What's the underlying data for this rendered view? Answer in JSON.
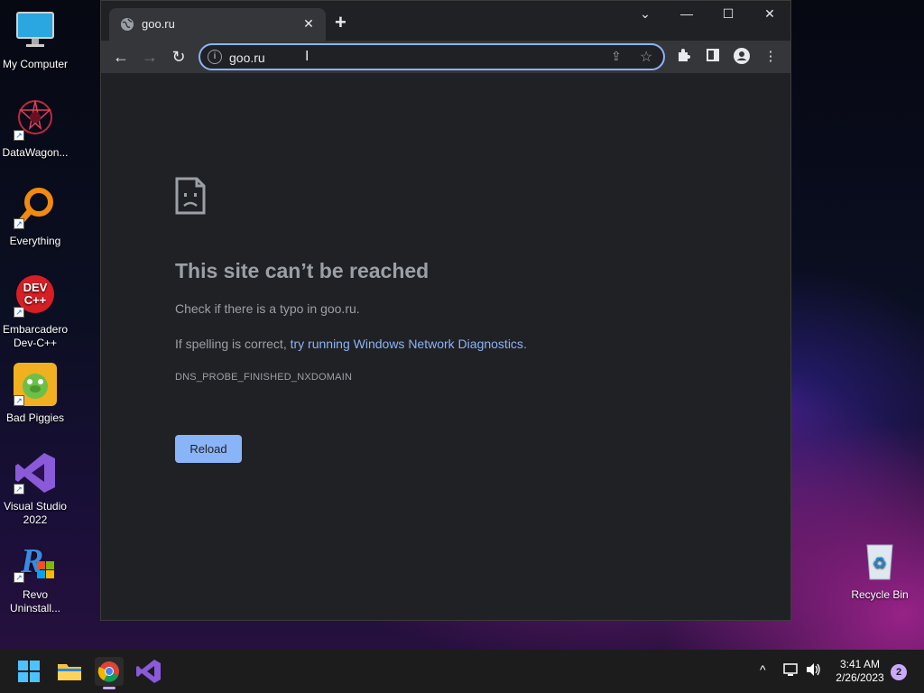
{
  "desktop": {
    "icons": [
      {
        "label": "My Computer"
      },
      {
        "label": "DataWagon..."
      },
      {
        "label": "Everything"
      },
      {
        "label": "Embarcadero Dev-C++"
      },
      {
        "label": "Bad Piggies"
      },
      {
        "label": "Visual Studio 2022"
      },
      {
        "label": "Revo Uninstall..."
      },
      {
        "label": "Recycle Bin"
      }
    ]
  },
  "browser": {
    "tab": {
      "title": "goo.ru",
      "close": "✕"
    },
    "new_tab": "+",
    "window_controls": {
      "menu": "⌄",
      "minimize": "—",
      "maximize": "☐",
      "close": "✕"
    },
    "nav": {
      "back": "←",
      "forward": "→",
      "reload": "↻"
    },
    "omnibox": {
      "info": "i",
      "url": "goo.ru"
    },
    "error": {
      "title": "This site can’t be reached",
      "line1": "Check if there is a typo in goo.ru.",
      "line2_prefix": "If spelling is correct, ",
      "line2_link": "try running Windows Network Diagnostics",
      "line2_suffix": ".",
      "code": "DNS_PROBE_FINISHED_NXDOMAIN",
      "reload_label": "Reload"
    }
  },
  "taskbar": {
    "clock_time": "3:41 AM",
    "clock_date": "2/26/2023",
    "notification_count": "2"
  },
  "colors": {
    "accent": "#8ab4f8",
    "surface": "#202124",
    "toolbar": "#35363a"
  }
}
